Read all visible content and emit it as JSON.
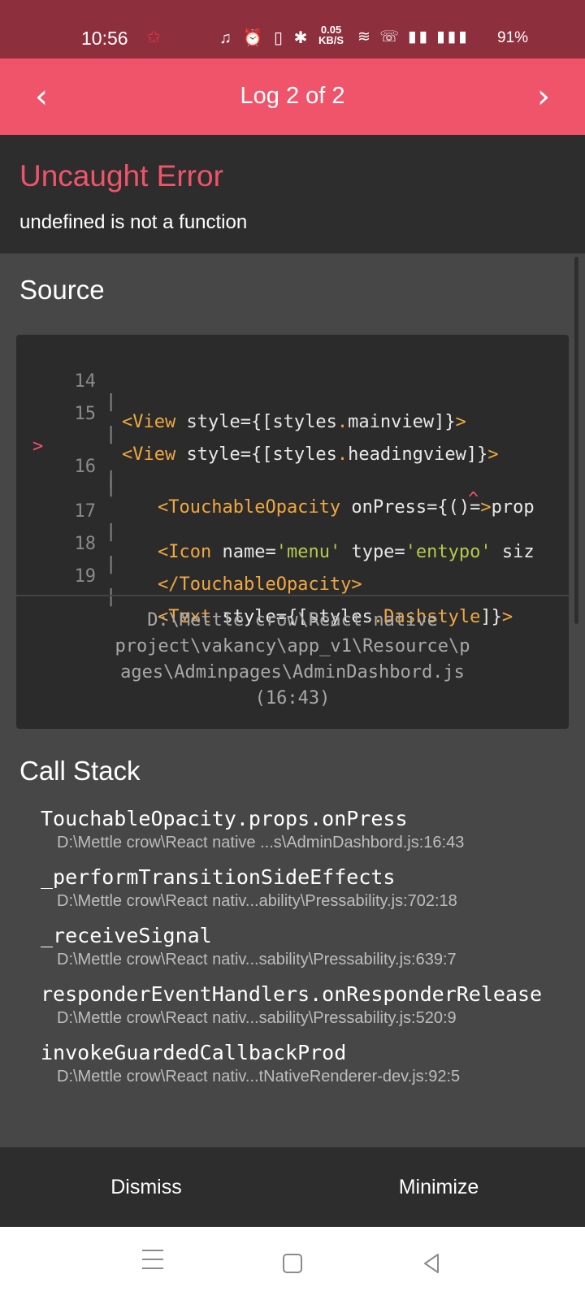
{
  "status_bar": {
    "time": "10:56",
    "speed_value": "0.05",
    "speed_unit": "KB/S",
    "battery": "91%"
  },
  "header": {
    "title": "Log 2 of 2"
  },
  "error": {
    "title": "Uncaught Error",
    "message": "undefined is not a function"
  },
  "source": {
    "heading": "Source",
    "line_numbers": [
      "14",
      "15",
      "16",
      "",
      "17",
      "18",
      "19"
    ],
    "marker": ">",
    "file_path": "D:\\Mettle crow\\React native project\\vakancy\\app_v1\\Resource\\pages\\Adminpages\\AdminDashbord.js (16:43)",
    "file_path_lines": [
      "D:\\Mettle crow\\React native",
      "project\\vakancy\\app_v1\\Resource\\p",
      "ages\\Adminpages\\AdminDashbord.js",
      "(16:43)"
    ]
  },
  "call_stack": {
    "heading": "Call Stack",
    "frames": [
      {
        "fn": "TouchableOpacity.props.onPress",
        "loc": "D:\\Mettle crow\\React native ...s\\AdminDashbord.js:16:43"
      },
      {
        "fn": "_performTransitionSideEffects",
        "loc": "D:\\Mettle crow\\React nativ...ability\\Pressability.js:702:18"
      },
      {
        "fn": "_receiveSignal",
        "loc": "D:\\Mettle crow\\React nativ...sability\\Pressability.js:639:7"
      },
      {
        "fn": "responderEventHandlers.onResponderRelease",
        "loc": "D:\\Mettle crow\\React nativ...sability\\Pressability.js:520:9"
      },
      {
        "fn": "invokeGuardedCallbackProd",
        "loc": "D:\\Mettle crow\\React nativ...tNativeRenderer-dev.js:92:5"
      }
    ]
  },
  "footer": {
    "dismiss": "Dismiss",
    "minimize": "Minimize"
  },
  "colors": {
    "accent": "#f0546a",
    "status_bar": "#8e2f3d",
    "panel": "#2d2d2d",
    "body": "#474747"
  }
}
